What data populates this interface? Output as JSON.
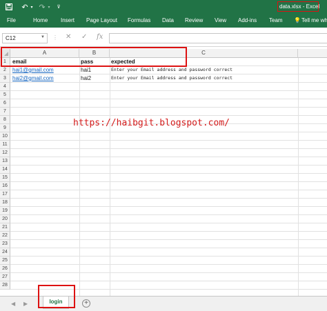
{
  "window": {
    "title": "data.xlsx - Excel"
  },
  "quick_access": {
    "save_icon": "save-icon",
    "undo_icon": "undo-icon",
    "redo_icon": "redo-icon"
  },
  "ribbon": {
    "tabs": [
      "File",
      "Home",
      "Insert",
      "Page Layout",
      "Formulas",
      "Data",
      "Review",
      "View",
      "Add-ins",
      "Team",
      "Tell me wh"
    ]
  },
  "formula_bar": {
    "name_box": "C12",
    "cancel_glyph": "✕",
    "enter_glyph": "✓",
    "fx_label": "fx",
    "formula": ""
  },
  "columns": [
    "A",
    "B",
    "C"
  ],
  "rows": [
    "1",
    "2",
    "3",
    "4",
    "5",
    "6",
    "7",
    "8",
    "9",
    "10",
    "11",
    "12",
    "13",
    "14",
    "15",
    "16",
    "17",
    "18",
    "19",
    "20",
    "21",
    "22",
    "23",
    "24",
    "25",
    "26",
    "27",
    "28"
  ],
  "table": {
    "headers": [
      "email",
      "pass",
      "expected"
    ],
    "data": [
      [
        "hai1@gmail.com",
        "hai1",
        "Enter your Email address and password correct"
      ],
      [
        "hai2@gmail.com",
        "hai2",
        "Enter your Email address and password correct"
      ]
    ]
  },
  "watermark": "https://haibgit.blogspot.com/",
  "sheets": {
    "active": "login",
    "add_label": "+"
  },
  "colors": {
    "excel_green": "#217346",
    "highlight_red": "#dd1111",
    "link_blue": "#1565c0",
    "watermark_red": "#d41c1c"
  }
}
